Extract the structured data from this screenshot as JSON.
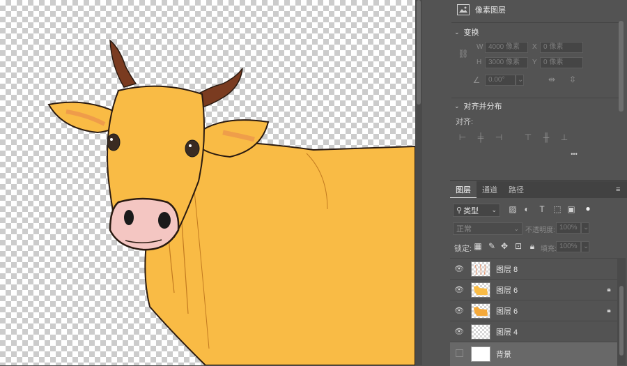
{
  "properties": {
    "pixel_layer_label": "像素图层",
    "transform": {
      "title": "变换",
      "w_label": "W",
      "w_value": "4000 像素",
      "x_label": "X",
      "x_value": "0 像素",
      "h_label": "H",
      "h_value": "3000 像素",
      "y_label": "Y",
      "y_value": "0 像素",
      "angle_value": "0.00°"
    },
    "align": {
      "title": "对齐并分布",
      "align_label": "对齐:",
      "more": "•••"
    }
  },
  "layers_panel": {
    "tabs": [
      "图层",
      "通道",
      "路径"
    ],
    "filter_kind": "类型",
    "blend_mode": "正常",
    "opacity_label": "不透明度:",
    "opacity_value": "100%",
    "lock_label": "锁定:",
    "fill_label": "填充:",
    "fill_value": "100%",
    "layers": [
      {
        "name": "图层 8",
        "visible": true,
        "locked": false
      },
      {
        "name": "图层 6",
        "visible": true,
        "locked": true
      },
      {
        "name": "图层 6",
        "visible": true,
        "locked": true
      },
      {
        "name": "图层 4",
        "visible": true,
        "locked": false
      },
      {
        "name": "背景",
        "visible": false,
        "locked": false,
        "selected": true
      }
    ]
  },
  "colors": {
    "panel_bg": "#535353",
    "cow_body": "#f9bb45",
    "horn": "#7a3b20"
  },
  "icons": {
    "eye": "eye-icon",
    "lock": "lock-icon",
    "link": "link-icon",
    "angle": "angle-icon"
  }
}
